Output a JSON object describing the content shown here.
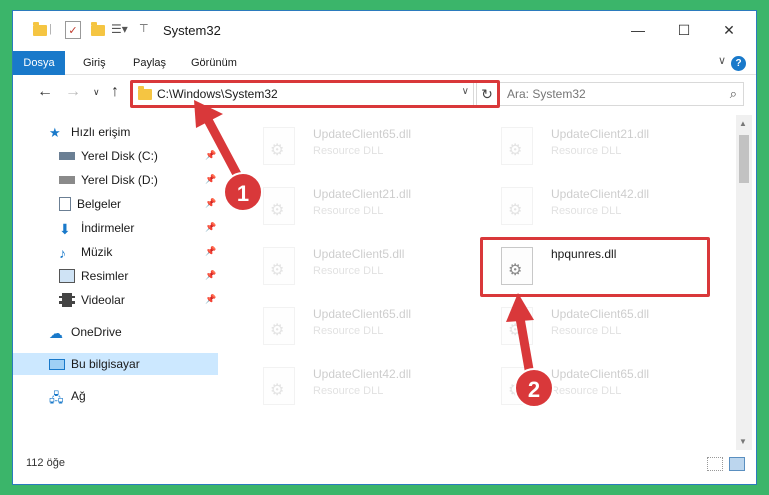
{
  "window": {
    "title": "System32",
    "controls": {
      "minimize": "—",
      "maximize": "☐",
      "close": "✕"
    }
  },
  "ribbon": {
    "tabs": [
      {
        "label": "Dosya",
        "active": true
      },
      {
        "label": "Giriş"
      },
      {
        "label": "Paylaş"
      },
      {
        "label": "Görünüm"
      }
    ],
    "help_label": "?"
  },
  "navigation": {
    "address": "C:\\Windows\\System32",
    "search_placeholder": "Ara: System32"
  },
  "sidebar": {
    "items": [
      {
        "label": "Hızlı erişim",
        "icon": "star-icon",
        "pinned": false
      },
      {
        "label": "Yerel Disk (C:)",
        "icon": "disk-icon",
        "pinned": true
      },
      {
        "label": "Yerel Disk (D:)",
        "icon": "disk-icon",
        "pinned": true
      },
      {
        "label": "Belgeler",
        "icon": "document-icon",
        "pinned": true
      },
      {
        "label": "İndirmeler",
        "icon": "download-icon",
        "pinned": true
      },
      {
        "label": "Müzik",
        "icon": "music-icon",
        "pinned": true
      },
      {
        "label": "Resimler",
        "icon": "pictures-icon",
        "pinned": true
      },
      {
        "label": "Videolar",
        "icon": "video-icon",
        "pinned": true
      },
      {
        "label": "OneDrive",
        "icon": "cloud-icon",
        "pinned": false
      },
      {
        "label": "Bu bilgisayar",
        "icon": "computer-icon",
        "pinned": false,
        "selected": true
      },
      {
        "label": "Ağ",
        "icon": "network-icon",
        "pinned": false
      }
    ]
  },
  "files": [
    {
      "name": "UpdateClient65.dll",
      "type": "Resource DLL"
    },
    {
      "name": "UpdateClient21.dll",
      "type": "Resource DLL"
    },
    {
      "name": "UpdateClient21.dll",
      "type": "Resource DLL"
    },
    {
      "name": "UpdateClient42.dll",
      "type": "Resource DLL"
    },
    {
      "name": "UpdateClient5.dll",
      "type": "Resource DLL"
    },
    {
      "name": "hpqunres.dll",
      "type": "",
      "highlighted": true
    },
    {
      "name": "UpdateClient65.dll",
      "type": "Resource DLL"
    },
    {
      "name": "UpdateClient65.dll",
      "type": "Resource DLL"
    },
    {
      "name": "UpdateClient42.dll",
      "type": "Resource DLL"
    },
    {
      "name": "UpdateClient65.dll",
      "type": "Resource DLL"
    }
  ],
  "status": {
    "item_count": "112 öğe"
  },
  "annotations": {
    "step1": "1",
    "step2": "2",
    "color": "#d9383a"
  }
}
